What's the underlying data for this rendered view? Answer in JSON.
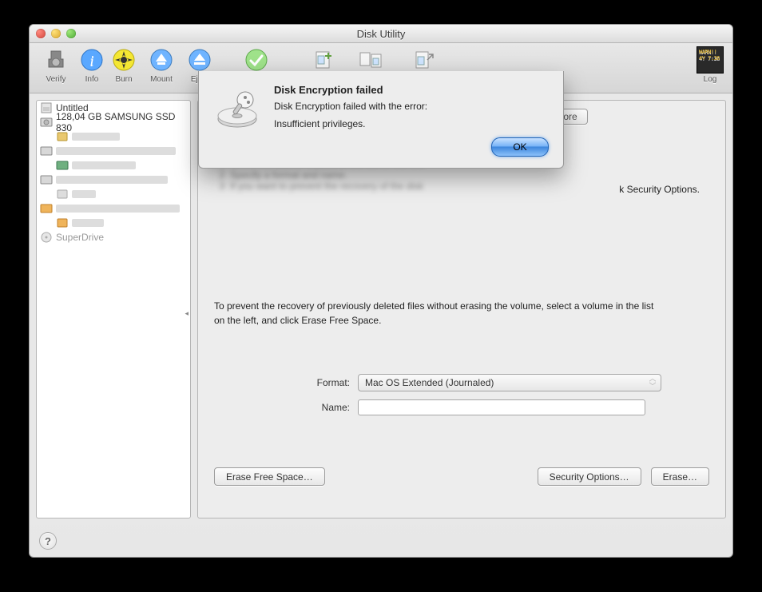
{
  "window": {
    "title": "Disk Utility"
  },
  "toolbar": {
    "verify": "Verify",
    "info": "Info",
    "burn": "Burn",
    "mount": "Mount",
    "eject": "Eject",
    "journal": "Enable Journaling",
    "newimage": "New Image",
    "convert": "Convert",
    "resize": "Resize Image",
    "log": "Log"
  },
  "sidebar": {
    "items": [
      {
        "label": "Untitled"
      },
      {
        "label": "128,04 GB SAMSUNG SSD 830"
      }
    ],
    "superdrive": "SuperDrive"
  },
  "tabs": {
    "restore": "Restore"
  },
  "erase": {
    "info_visible": "k Security Options.",
    "helptext": "To prevent the recovery of previously deleted files without erasing the volume, select a volume in the list on the left, and click Erase Free Space.",
    "format_label": "Format:",
    "format_value": "Mac OS Extended (Journaled)",
    "name_label": "Name:",
    "name_value": "",
    "btn_free": "Erase Free Space…",
    "btn_sec": "Security Options…",
    "btn_erase": "Erase…"
  },
  "dialog": {
    "title": "Disk Encryption failed",
    "line1": "Disk Encryption failed with the error:",
    "line2": "Insufficient privileges.",
    "ok": "OK"
  },
  "help": "?"
}
